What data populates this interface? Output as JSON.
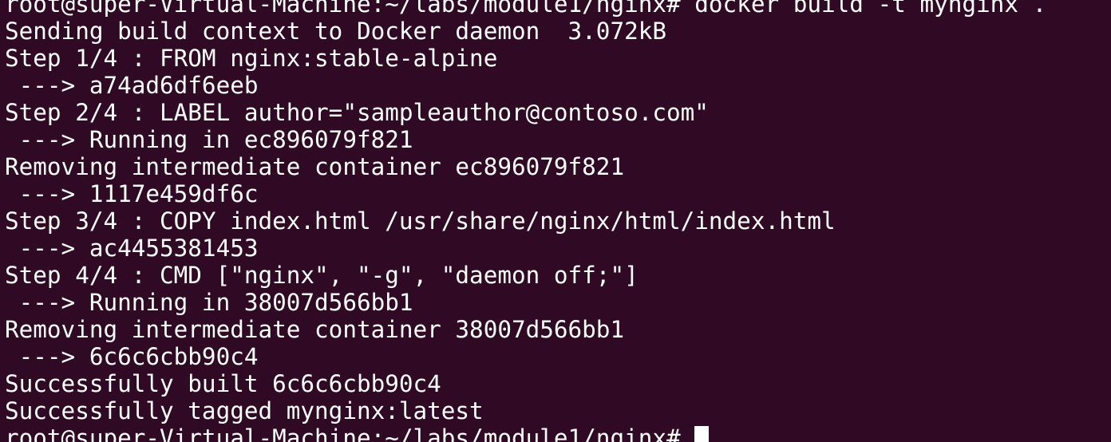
{
  "terminal": {
    "background": "#300a24",
    "foreground": "#ffffff",
    "lines": [
      "root@super-Virtual-Machine:~/labs/module1/nginx# docker build -t mynginx .",
      "Sending build context to Docker daemon  3.072kB",
      "Step 1/4 : FROM nginx:stable-alpine",
      " ---> a74ad6df6eeb",
      "Step 2/4 : LABEL author=\"sampleauthor@contoso.com\"",
      " ---> Running in ec896079f821",
      "Removing intermediate container ec896079f821",
      " ---> 1117e459df6c",
      "Step 3/4 : COPY index.html /usr/share/nginx/html/index.html",
      " ---> ac4455381453",
      "Step 4/4 : CMD [\"nginx\", \"-g\", \"daemon off;\"]",
      " ---> Running in 38007d566bb1",
      "Removing intermediate container 38007d566bb1",
      " ---> 6c6c6cbb90c4",
      "Successfully built 6c6c6cbb90c4",
      "Successfully tagged mynginx:latest"
    ],
    "prompt": "root@super-Virtual-Machine:~/labs/module1/nginx# "
  }
}
